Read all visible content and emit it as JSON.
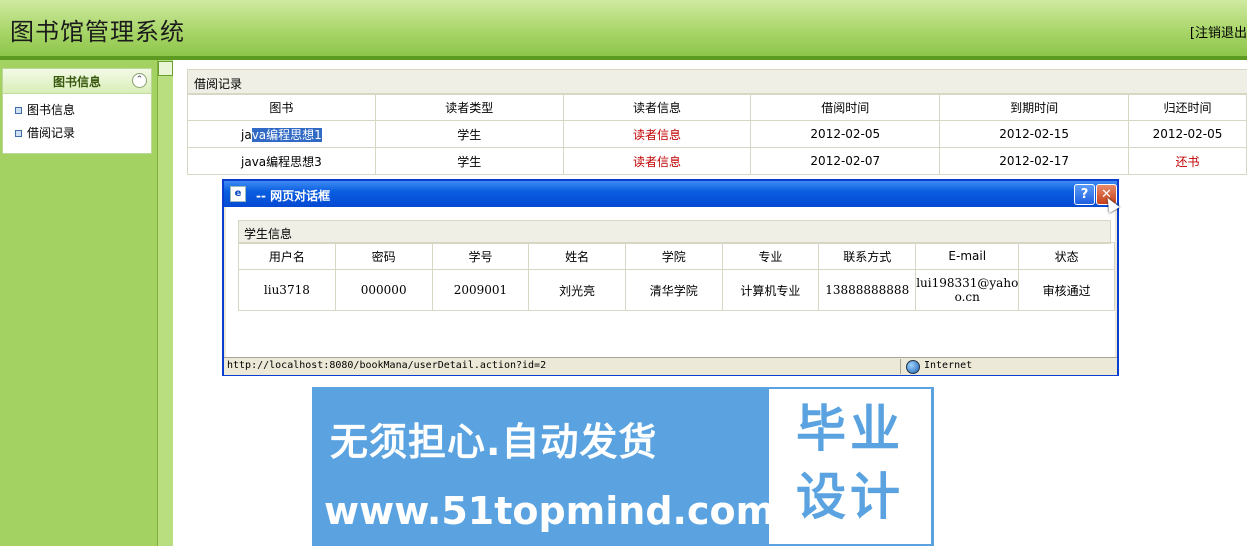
{
  "header": {
    "title": "图书馆管理系统",
    "logout_label": "[注销退出"
  },
  "sidebar": {
    "panel_title": "图书信息",
    "items": [
      {
        "label": "图书信息"
      },
      {
        "label": "借阅记录"
      }
    ]
  },
  "records": {
    "title": "借阅记录",
    "columns": [
      "图书",
      "读者类型",
      "读者信息",
      "借阅时间",
      "到期时间",
      "归还时间"
    ],
    "rows": [
      {
        "book_pre": "ja",
        "book_sel": "va编程思想1",
        "reader_type": "学生",
        "reader_info": "读者信息",
        "borrow": "2012-02-05",
        "due": "2012-02-15",
        "returned": "2012-02-05"
      },
      {
        "book_pre": "java编程思想3",
        "book_sel": "",
        "reader_type": "学生",
        "reader_info": "读者信息",
        "borrow": "2012-02-07",
        "due": "2012-02-17",
        "returned": "还书"
      }
    ]
  },
  "dialog": {
    "title": "-- 网页对话框",
    "help_label": "?",
    "close_label": "✕",
    "section_title": "学生信息",
    "columns": [
      "用户名",
      "密码",
      "学号",
      "姓名",
      "学院",
      "专业",
      "联系方式",
      "E-mail",
      "状态"
    ],
    "row": {
      "username": "liu3718",
      "password": "000000",
      "student_no": "2009001",
      "name": "刘光亮",
      "college": "清华学院",
      "major": "计算机专业",
      "phone": "13888888888",
      "email_1": "lui198331@yaho",
      "email_2": "o.cn",
      "status": "审核通过"
    },
    "status_url": "http://localhost:8080/bookMana/userDetail.action?id=2",
    "zone": "Internet"
  },
  "watermark": {
    "slogan": "无须担心.自动发货",
    "url": "www.51topmind.com",
    "box_line1": "毕业",
    "box_line2": "设计"
  },
  "colors": {
    "header_green": "#8dc64a",
    "sidebar_green": "#a3d162",
    "dialog_blue": "#0a5ee0",
    "link_red": "#c00000",
    "watermark_blue": "#5aa3e0"
  }
}
